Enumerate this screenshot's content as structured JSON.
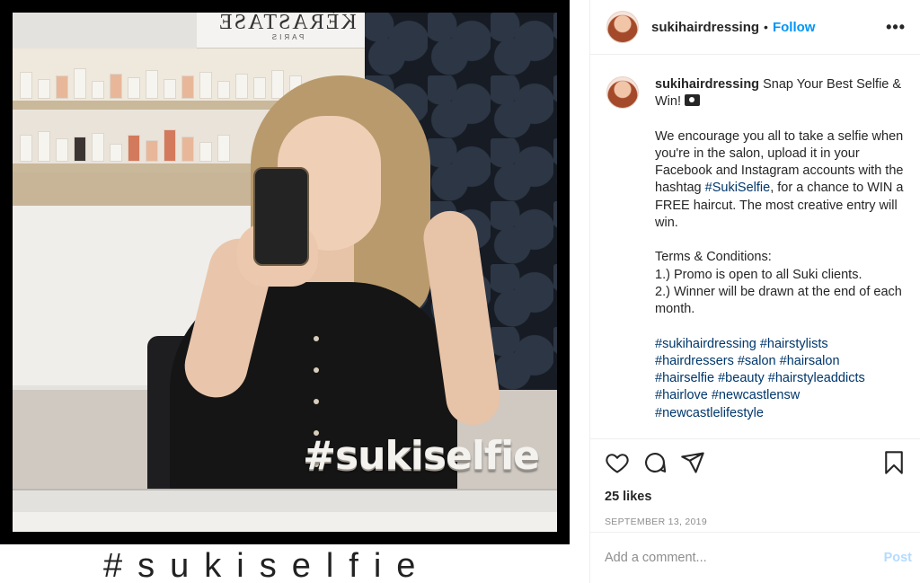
{
  "photo": {
    "sign_text": "KÉRASTASE",
    "sign_sub": "PARIS",
    "overlay_hashtag": "#sukiselfie",
    "caption_hashtag": "#sukiselfie"
  },
  "header": {
    "username": "sukihairdressing",
    "separator": "•",
    "follow_label": "Follow",
    "more_label": "•••"
  },
  "caption": {
    "username": "sukihairdressing",
    "title": "Snap Your Best Selfie & Win!",
    "camera_icon": "camera-icon",
    "paragraph1_before": "We encourage you all to take a selfie when you're in the salon, upload it in your Facebook and Instagram accounts with the hashtag",
    "paragraph1_tag": "#SukiSelfie",
    "paragraph1_after": ", for a chance to WIN a FREE haircut. The most creative entry will win.",
    "terms_title": "Terms & Conditions:",
    "terms_1": "1.) Promo is open to all Suki clients.",
    "terms_2": "2.) Winner will be drawn at the end of each month.",
    "hashtags_line1": "#sukihairdressing #hairstylists",
    "hashtags_line2": "#hairdressers #salon #hairsalon",
    "hashtags_line3": "#hairselfie #beauty #hairstyleaddicts",
    "hashtags_line4": "#hairlove #newcastlensw",
    "hashtags_line5": "#newcastlelifestyle"
  },
  "actions": {
    "icons": [
      "heart-icon",
      "comment-icon",
      "share-icon",
      "bookmark-icon"
    ],
    "likes": "25 likes",
    "date": "SEPTEMBER 13, 2019"
  },
  "comment": {
    "placeholder": "Add a comment...",
    "post_label": "Post"
  }
}
